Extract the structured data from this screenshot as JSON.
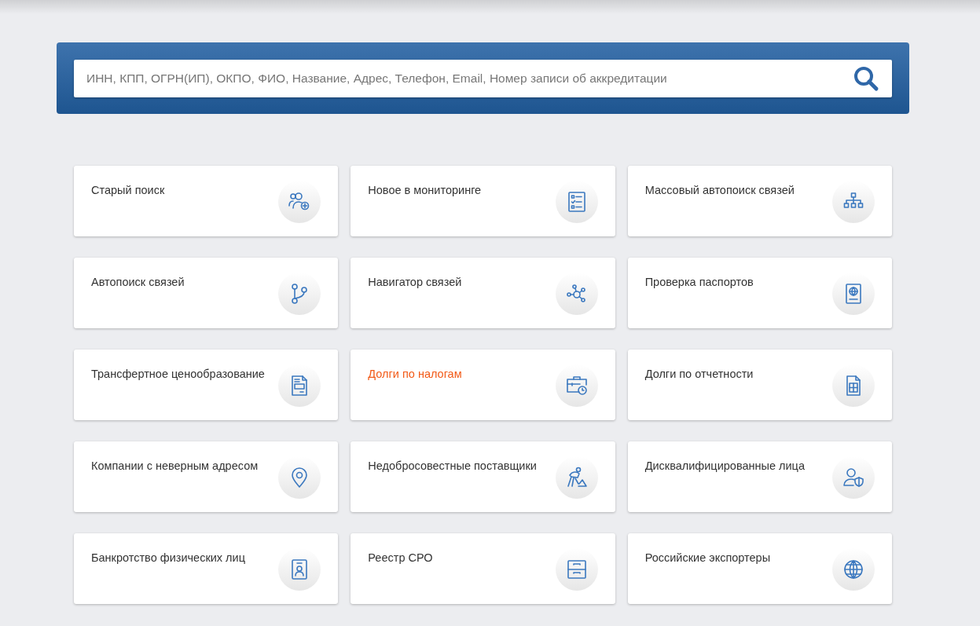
{
  "search": {
    "placeholder": "ИНН, КПП, ОГРН(ИП), ОКПО, ФИО, Название, Адрес, Телефон, Email, Номер записи об аккредитации"
  },
  "tiles": [
    {
      "label": "Старый поиск",
      "selected": false
    },
    {
      "label": "Новое в мониторинге",
      "selected": false
    },
    {
      "label": "Массовый автопоиск связей",
      "selected": false
    },
    {
      "label": "Автопоиск связей",
      "selected": false
    },
    {
      "label": "Навигатор связей",
      "selected": false
    },
    {
      "label": "Проверка паспортов",
      "selected": false
    },
    {
      "label": "Трансфертное ценообразование",
      "selected": false
    },
    {
      "label": "Долги по налогам",
      "selected": true
    },
    {
      "label": "Долги по отчетности",
      "selected": false
    },
    {
      "label": "Компании с неверным адресом",
      "selected": false
    },
    {
      "label": "Недобросовестные поставщики",
      "selected": false
    },
    {
      "label": "Дисквалифицированные лица",
      "selected": false
    },
    {
      "label": "Банкротство физических лиц",
      "selected": false
    },
    {
      "label": "Реестр СРО",
      "selected": false
    },
    {
      "label": "Российские экспортеры",
      "selected": false
    }
  ]
}
